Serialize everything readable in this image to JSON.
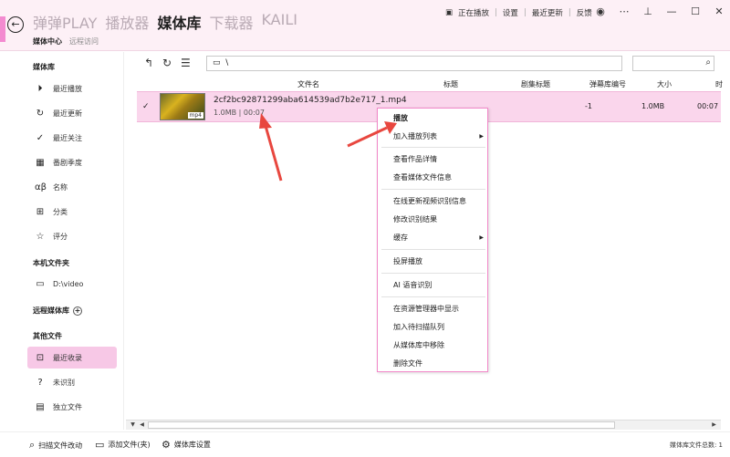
{
  "titlebar": {
    "tabs": [
      "弹弹PLAY",
      "播放器",
      "媒体库",
      "下载器",
      "KAILI"
    ],
    "active_tab": "媒体库",
    "subnav": [
      "媒体中心",
      "远程访问"
    ],
    "links": [
      "正在播放",
      "设置",
      "最近更新",
      "反馈"
    ]
  },
  "sidebar": {
    "section_library": "媒体库",
    "library_items": [
      {
        "label": "最近播放",
        "icon": "play-circle-icon"
      },
      {
        "label": "最近更新",
        "icon": "refresh-icon"
      },
      {
        "label": "最近关注",
        "icon": "check-circle-icon"
      },
      {
        "label": "番剧季度",
        "icon": "calendar-icon"
      },
      {
        "label": "名称",
        "icon": "alpha-beta-icon"
      },
      {
        "label": "分类",
        "icon": "category-icon"
      },
      {
        "label": "评分",
        "icon": "star-icon"
      }
    ],
    "section_local": "本机文件夹",
    "local_items": [
      {
        "label": "D:\\video",
        "icon": "folder-icon"
      }
    ],
    "section_remote": "远程媒体库",
    "section_other": "其他文件",
    "other_items": [
      {
        "label": "最近收录",
        "icon": "new-item-icon"
      },
      {
        "label": "未识别",
        "icon": "unknown-icon"
      },
      {
        "label": "独立文件",
        "icon": "file-icon"
      }
    ]
  },
  "toolbar": {
    "path": "\\"
  },
  "table": {
    "headers": [
      "文件名",
      "标题",
      "剧集标题",
      "弹幕库编号",
      "大小",
      "时"
    ],
    "row": {
      "thumb_tag": "mp4",
      "filename": "2cf2bc92871299aba614539ad7b2e717_1.mp4",
      "meta": "1.0MB | 00:07",
      "episode_id": "-1",
      "size": "1.0MB",
      "duration": "00:07"
    }
  },
  "context_menu": {
    "play": "播放",
    "add_playlist": "加入播放列表",
    "view_work": "查看作品详情",
    "view_media": "查看媒体文件信息",
    "update_online": "在线更新视频识别信息",
    "edit_result": "修改识别结果",
    "cache": "缓存",
    "cast": "投屏播放",
    "ai_speech": "AI 语音识别",
    "show_explorer": "在资源管理器中显示",
    "add_scan_queue": "加入待扫描队列",
    "remove_library": "从媒体库中移除",
    "delete_file": "删除文件"
  },
  "statusbar": {
    "scan": "扫描文件改动",
    "add_file": "添加文件(夹)",
    "settings": "媒体库设置",
    "total": "媒体库文件总数: 1"
  },
  "colors": {
    "accent": "#f38bd0",
    "selection": "#fad6ec",
    "arrow": "#e8473f"
  }
}
